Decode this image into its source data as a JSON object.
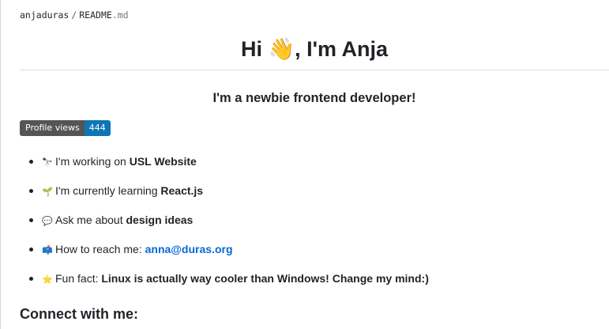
{
  "breadcrumb": {
    "owner": "anjaduras",
    "separator": "/",
    "file_name": "README",
    "file_ext": ".md"
  },
  "heading": {
    "greeting": "Hi ",
    "wave_emoji": "👋",
    "name": ", I'm Anja"
  },
  "subtitle": "I'm a newbie frontend developer!",
  "badge": {
    "label": "Profile views",
    "count": "444"
  },
  "facts": [
    {
      "icon": "telescope-icon",
      "emoji": "🔭",
      "prefix": "I'm working on ",
      "value": "USL Website"
    },
    {
      "icon": "seedling-icon",
      "emoji": "🌱",
      "prefix": "I'm currently learning ",
      "value": "React.js"
    },
    {
      "icon": "speech-balloon-icon",
      "emoji": "💬",
      "prefix": "Ask me about ",
      "value": "design ideas"
    },
    {
      "icon": "mailbox-icon",
      "emoji": "📫",
      "prefix": "How to reach me: ",
      "value": "anna@duras.org"
    },
    {
      "icon": "star-icon",
      "emoji": "⭐",
      "prefix": "Fun fact: ",
      "value": "Linux is actually way cooler than Windows! Change my mind:)"
    }
  ],
  "connect_heading": "Connect with me:",
  "colors": {
    "text": "#1f2328",
    "link": "#0969da",
    "badge_label_bg": "#555555",
    "badge_value_bg": "#0e75b6",
    "rule": "#d8dee4"
  }
}
